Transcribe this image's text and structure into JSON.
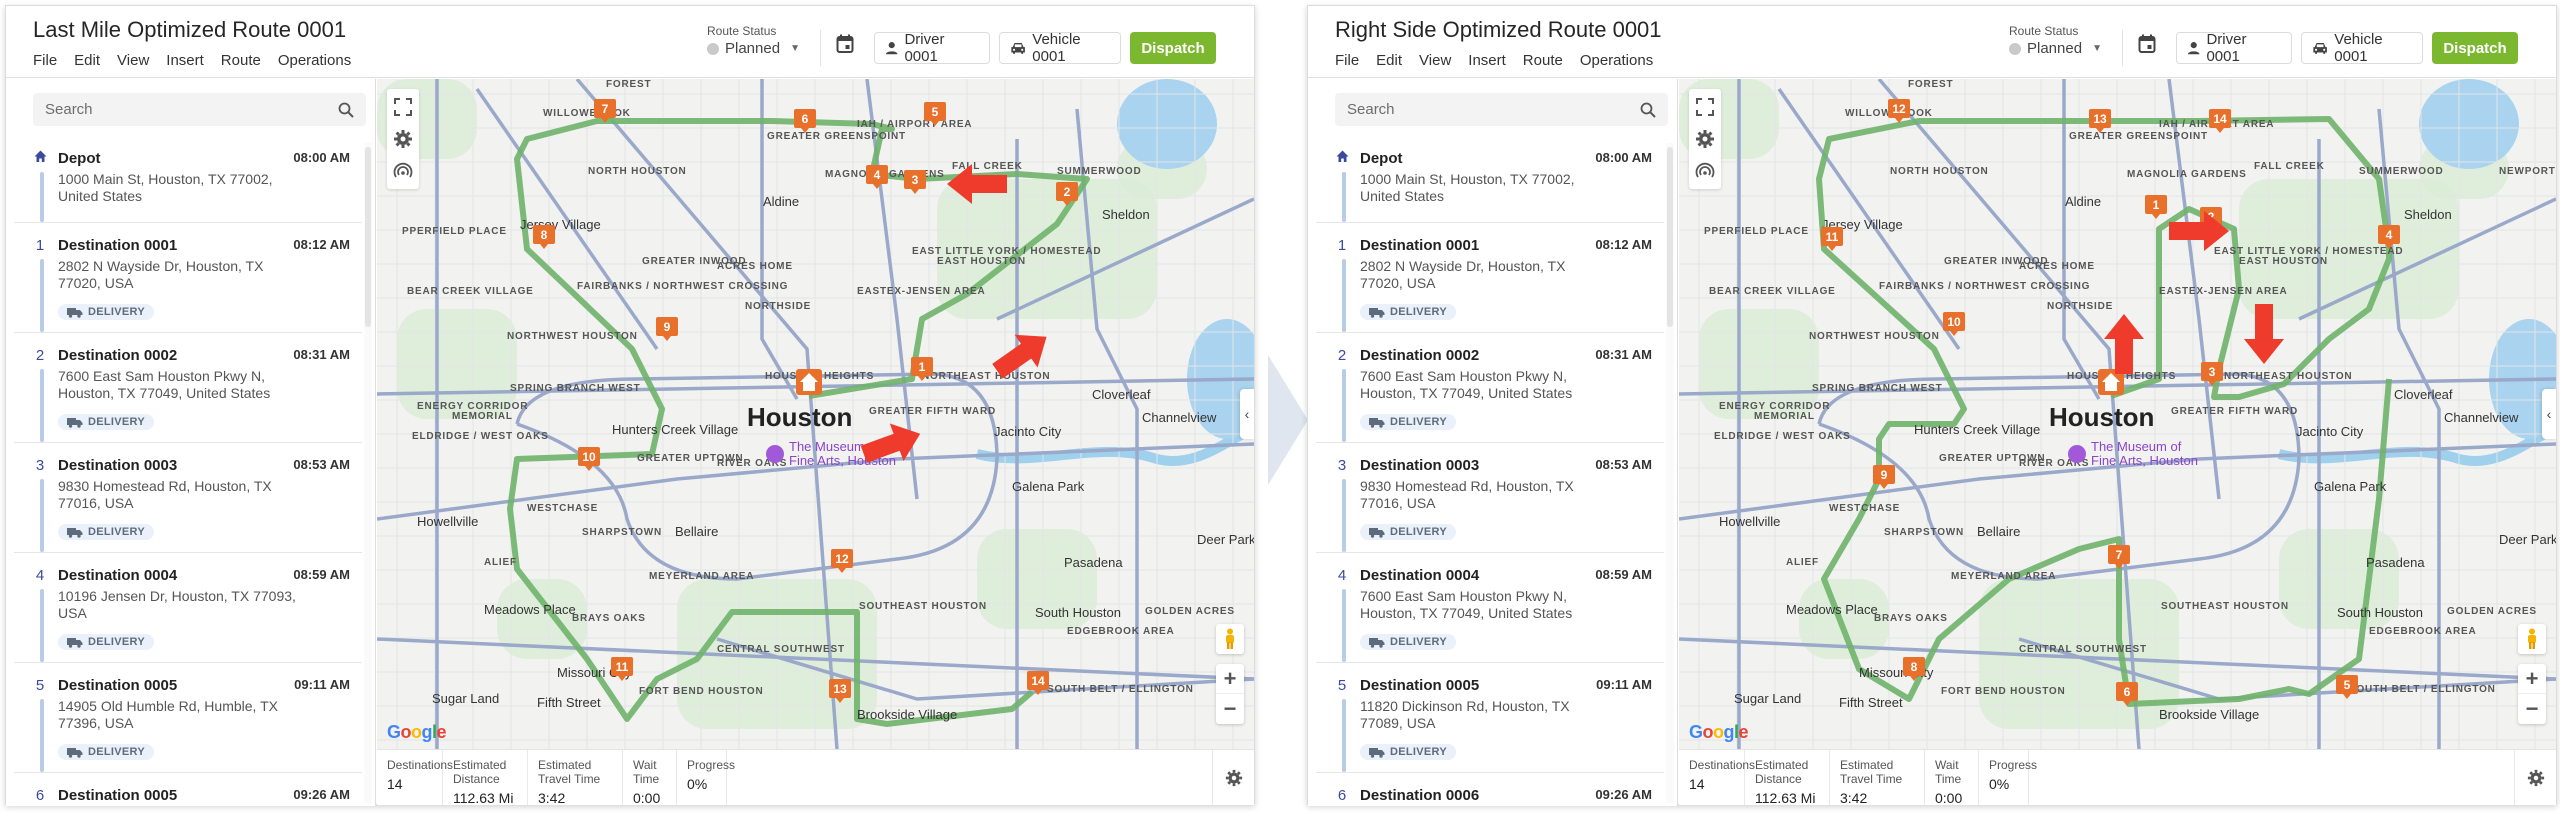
{
  "transition_arrow": "chevron-right-arrow",
  "panels": [
    {
      "id": "left",
      "title": "Last Mile Optimized Route 0001",
      "menu": [
        "File",
        "Edit",
        "View",
        "Insert",
        "Route",
        "Operations"
      ],
      "route_status_label": "Route Status",
      "route_status_value": "Planned",
      "driver_label": "Driver 0001",
      "vehicle_label": "Vehicle 0001",
      "dispatch_label": "Dispatch",
      "search_placeholder": "Search",
      "stops": [
        {
          "index": "",
          "icon": "home-icon",
          "name": "Depot",
          "time": "08:00 AM",
          "address": "1000 Main St, Houston, TX 77002, United States",
          "tag": ""
        },
        {
          "index": "1",
          "name": "Destination 0001",
          "time": "08:12 AM",
          "address": "2802 N Wayside Dr, Houston, TX 77020, USA",
          "tag": "DELIVERY"
        },
        {
          "index": "2",
          "name": "Destination 0002",
          "time": "08:31 AM",
          "address": "7600 East Sam Houston Pkwy N, Houston, TX 77049, United States",
          "tag": "DELIVERY"
        },
        {
          "index": "3",
          "name": "Destination 0003",
          "time": "08:53 AM",
          "address": "9830 Homestead Rd, Houston, TX 77016, USA",
          "tag": "DELIVERY"
        },
        {
          "index": "4",
          "name": "Destination 0004",
          "time": "08:59 AM",
          "address": "10196 Jensen Dr, Houston, TX 77093, USA",
          "tag": "DELIVERY"
        },
        {
          "index": "5",
          "name": "Destination 0005",
          "time": "09:11 AM",
          "address": "14905 Old Humble Rd, Humble, TX 77396, USA",
          "tag": "DELIVERY"
        },
        {
          "index": "6",
          "name": "Destination 0005",
          "time": "09:26 AM",
          "address": "",
          "tag": ""
        }
      ],
      "map": {
        "city_label": "Houston",
        "poi_label": "The Museum of Fine Arts, Houston",
        "labels": [
          "FOREST",
          "WILLOWBROOK",
          "NORTH HOUSTON",
          "GREATER GREENSPOINT",
          "IAH / AIRPORT AREA",
          "MAGNOLIA GARDENS",
          "Aldine",
          "Jersey Village",
          "GREATER INWOOD",
          "ACRES HOME",
          "FAIRBANKS / NORTHWEST CROSSING",
          "NORTHSIDE",
          "EASTEX-JENSEN AREA",
          "EAST LITTLE YORK / HOMESTEAD",
          "EAST HOUSTON",
          "NORTHWEST HOUSTON",
          "HOUSTON HEIGHTS",
          "SPRING BRANCH WEST",
          "NORTHEAST HOUSTON",
          "GREATER FIFTH WARD",
          "Sheldon",
          "Cloverleaf",
          "Channelview",
          "Jacinto City",
          "Galena Park",
          "Hunters Creek Village",
          "GREATER UPTOWN",
          "RIVER OAKS",
          "WESTCHASE",
          "Howellville",
          "SHARPSTOWN",
          "Bellaire",
          "ALIEF",
          "MEYERLAND AREA",
          "Meadows Place",
          "BRAYS OAKS",
          "SOUTHEAST HOUSTON",
          "CENTRAL SOUTHWEST",
          "Missouri City",
          "FORT BEND HOUSTON",
          "Sugar Land",
          "Fifth Street",
          "Brookside Village",
          "Pasadena",
          "Deer Park",
          "South Houston",
          "GOLDEN ACRES",
          "EDGEBROOK AREA",
          "SOUTH BELT / ELLINGTON",
          "SUMMERWOOD",
          "FALL CREEK",
          "PPERFIELD PLACE",
          "BEAR CREEK VILLAGE",
          "ENERGY CORRIDOR",
          "MEMORIAL",
          "ELDRIDGE / WEST OAKS"
        ],
        "route_markers": [
          "1",
          "2",
          "3",
          "4",
          "5",
          "6",
          "7",
          "8",
          "9",
          "10",
          "11",
          "12",
          "13",
          "14"
        ],
        "google_label": "Google"
      },
      "stats": [
        {
          "label": "Destinations",
          "value": "14"
        },
        {
          "label": "Estimated Distance",
          "value": "112.63 Mi"
        },
        {
          "label": "Estimated Travel Time",
          "value": "3:42"
        },
        {
          "label": "Wait Time",
          "value": "0:00"
        },
        {
          "label": "Progress",
          "value": "0%"
        }
      ]
    },
    {
      "id": "right",
      "title": "Right Side Optimized Route 0001",
      "menu": [
        "File",
        "Edit",
        "View",
        "Insert",
        "Route",
        "Operations"
      ],
      "route_status_label": "Route Status",
      "route_status_value": "Planned",
      "driver_label": "Driver 0001",
      "vehicle_label": "Vehicle 0001",
      "dispatch_label": "Dispatch",
      "search_placeholder": "Search",
      "stops": [
        {
          "index": "",
          "icon": "home-icon",
          "name": "Depot",
          "time": "08:00 AM",
          "address": "1000 Main St, Houston, TX 77002, United States",
          "tag": ""
        },
        {
          "index": "1",
          "name": "Destination 0001",
          "time": "08:12 AM",
          "address": "2802 N Wayside Dr, Houston, TX 77020, USA",
          "tag": "DELIVERY"
        },
        {
          "index": "2",
          "name": "Destination 0002",
          "time": "08:31 AM",
          "address": "7600 East Sam Houston Pkwy N, Houston, TX 77049, United States",
          "tag": "DELIVERY"
        },
        {
          "index": "3",
          "name": "Destination 0003",
          "time": "08:53 AM",
          "address": "9830 Homestead Rd, Houston, TX 77016, USA",
          "tag": "DELIVERY"
        },
        {
          "index": "4",
          "name": "Destination 0004",
          "time": "08:59 AM",
          "address": "7600 East Sam Houston Pkwy N, Houston, TX 77049, United States",
          "tag": "DELIVERY"
        },
        {
          "index": "5",
          "name": "Destination 0005",
          "time": "09:11 AM",
          "address": "11820 Dickinson Rd, Houston, TX 77089, USA",
          "tag": "DELIVERY"
        },
        {
          "index": "6",
          "name": "Destination 0006",
          "time": "09:26 AM",
          "address": "",
          "tag": ""
        }
      ],
      "map": {
        "city_label": "Houston",
        "poi_label": "The Museum of Fine Arts, Houston",
        "labels": [
          "FOREST",
          "WILLOWBROOK",
          "NORTH HOUSTON",
          "GREATER GREENSPOINT",
          "IAH / AIRPORT AREA",
          "MAGNOLIA GARDENS",
          "Aldine",
          "Jersey Village",
          "GREATER INWOOD",
          "ACRES HOME",
          "FAIRBANKS / NORTHWEST CROSSING",
          "NORTHSIDE",
          "EASTEX-JENSEN AREA",
          "EAST LITTLE YORK / HOMESTEAD",
          "EAST HOUSTON",
          "NORTHWEST HOUSTON",
          "HOUSTON HEIGHTS",
          "SPRING BRANCH WEST",
          "NORTHEAST HOUSTON",
          "GREATER FIFTH WARD",
          "Sheldon",
          "Cloverleaf",
          "Channelview",
          "Jacinto City",
          "Galena Park",
          "Hunters Creek Village",
          "GREATER UPTOWN",
          "RIVER OAKS",
          "WESTCHASE",
          "Howellville",
          "SHARPSTOWN",
          "Bellaire",
          "ALIEF",
          "MEYERLAND AREA",
          "Meadows Place",
          "BRAYS OAKS",
          "SOUTHEAST HOUSTON",
          "CENTRAL SOUTHWEST",
          "Missouri City",
          "FORT BEND HOUSTON",
          "Sugar Land",
          "Fifth Street",
          "Brookside Village",
          "Pasadena",
          "Deer Park",
          "South Houston",
          "GOLDEN ACRES",
          "EDGEBROOK AREA",
          "SOUTH BELT / ELLINGTON",
          "SUMMERWOOD",
          "FALL CREEK",
          "NEWPORT",
          "PPERFIELD PLACE",
          "BEAR CREEK VILLAGE",
          "ENERGY CORRIDOR",
          "MEMORIAL",
          "ELDRIDGE / WEST OAKS"
        ],
        "route_markers": [
          "1",
          "2",
          "3",
          "4",
          "5",
          "6",
          "7",
          "8",
          "9",
          "10",
          "11",
          "12",
          "13",
          "14"
        ],
        "google_label": "Google"
      },
      "stats": [
        {
          "label": "Destinations",
          "value": "14"
        },
        {
          "label": "Estimated Distance",
          "value": "112.63 Mi"
        },
        {
          "label": "Estimated Travel Time",
          "value": "3:42"
        },
        {
          "label": "Wait Time",
          "value": "0:00"
        },
        {
          "label": "Progress",
          "value": "0%"
        }
      ]
    }
  ],
  "colors": {
    "dispatch_green": "#7cb82f",
    "marker_orange": "#e8702a",
    "route_green": "#6fb36a",
    "annotation_red": "#ee3b2b",
    "stop_index_blue": "#3b4a9c",
    "rail_blue": "#b9cbe6"
  }
}
